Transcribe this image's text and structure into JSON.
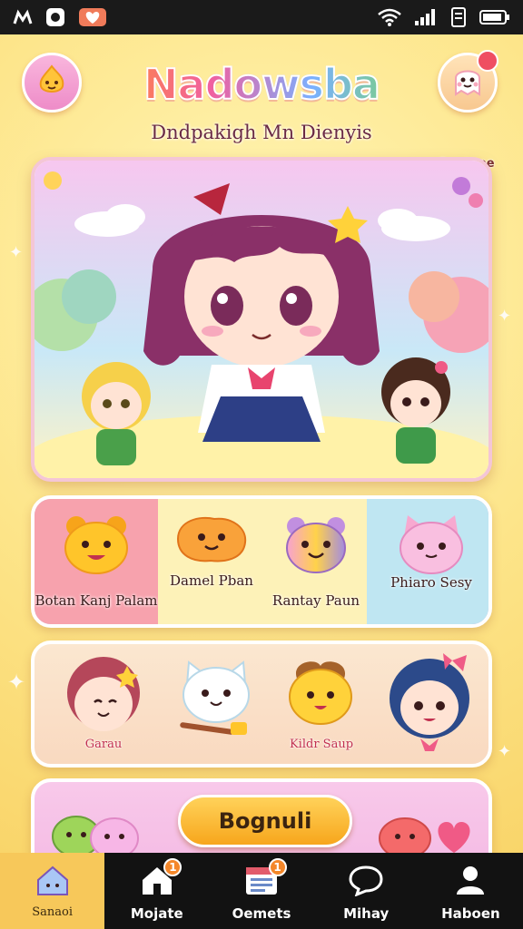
{
  "app": {
    "title": "Nadowsba",
    "subtitle": "Dndpakigh Mn Dienyis",
    "profile_label": "Bentape",
    "colors": {
      "accent": "#f7a61c",
      "background": "#fde58a",
      "nav": "#121212",
      "active_tab": "#f7c85a"
    }
  },
  "status_bar": {
    "left_icons": [
      "signal-m-icon",
      "circle-icon",
      "heart-app-icon"
    ],
    "right_icons": [
      "wifi-icon",
      "cell-signal-icon",
      "sim-icon",
      "battery-icon"
    ]
  },
  "hero": {
    "icons": [
      "sun-mascot-icon",
      "bow-icon",
      "flower-icon"
    ]
  },
  "pets": [
    {
      "label": "Botan Kanj Palam",
      "icon": "yellow-bear-icon"
    },
    {
      "label": "Damel Pban",
      "icon": "orange-fox-icon"
    },
    {
      "label": "Rantay Paun",
      "icon": "rainbow-bear-icon"
    },
    {
      "label": "Phiaro Sesy",
      "icon": "pink-cat-icon"
    }
  ],
  "characters": [
    {
      "label": "Garau",
      "icon": "pink-hair-girl-icon"
    },
    {
      "label": "",
      "icon": "white-cat-icon"
    },
    {
      "label": "Kildr Saup",
      "icon": "yellow-dog-icon"
    },
    {
      "label": "",
      "icon": "blue-hair-girl-icon"
    }
  ],
  "cta": {
    "label": "Bognuli"
  },
  "nav": {
    "items": [
      {
        "label": "Sanaoi",
        "icon": "house-icon",
        "badge": ""
      },
      {
        "label": "Mojate",
        "icon": "home-icon",
        "badge": "1"
      },
      {
        "label": "Oemets",
        "icon": "calendar-icon",
        "badge": "1"
      },
      {
        "label": "Mihay",
        "icon": "chat-bubble-icon",
        "badge": ""
      },
      {
        "label": "Haboen",
        "icon": "person-icon",
        "badge": ""
      }
    ]
  }
}
